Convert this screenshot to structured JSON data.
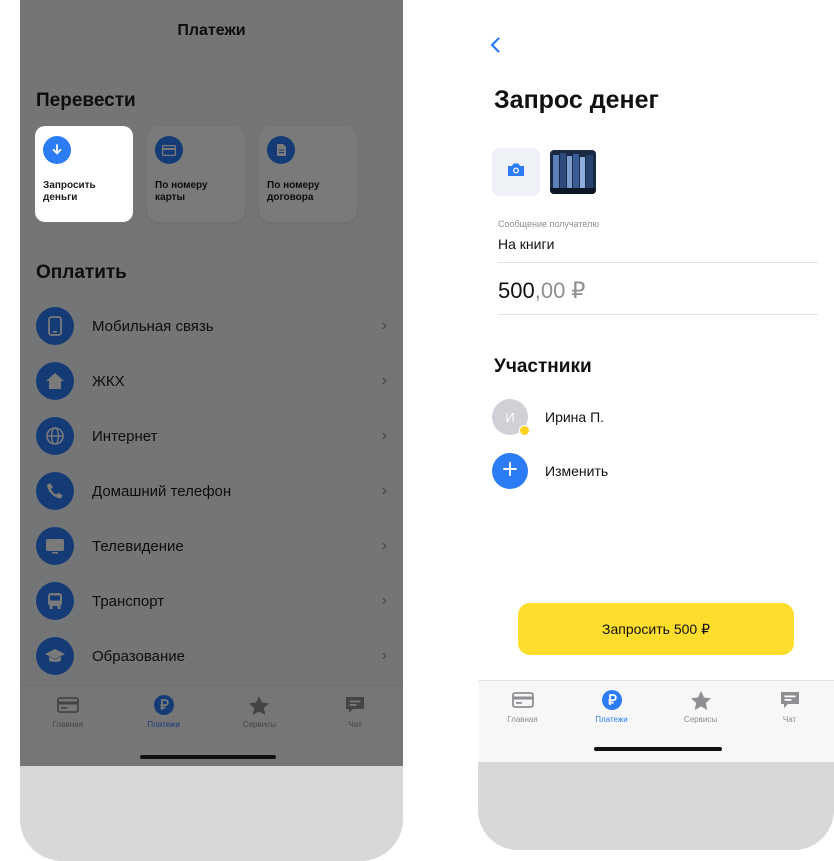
{
  "left_screen": {
    "title": "Платежи",
    "transfer": {
      "heading": "Перевести",
      "tiles": [
        {
          "label": "Запросить\nденьги",
          "icon": "arrow-down-circle-icon"
        },
        {
          "label": "По номеру\nкарты",
          "icon": "card-icon"
        },
        {
          "label": "По номеру\nдоговора",
          "icon": "document-icon"
        }
      ]
    },
    "pay": {
      "heading": "Оплатить",
      "items": [
        {
          "label": "Мобильная связь",
          "icon": "mobile-phone-icon"
        },
        {
          "label": "ЖКХ",
          "icon": "house-icon"
        },
        {
          "label": "Интернет",
          "icon": "globe-icon"
        },
        {
          "label": "Домашний телефон",
          "icon": "phone-handset-icon"
        },
        {
          "label": "Телевидение",
          "icon": "tv-icon"
        },
        {
          "label": "Транспорт",
          "icon": "bus-icon"
        },
        {
          "label": "Образование",
          "icon": "graduation-cap-icon"
        }
      ]
    },
    "tabbar": [
      {
        "label": "Главная",
        "icon": "card-icon",
        "active": false
      },
      {
        "label": "Платежи",
        "icon": "ruble-icon",
        "active": true
      },
      {
        "label": "Сервисы",
        "icon": "star-icon",
        "active": false
      },
      {
        "label": "Чат",
        "icon": "chat-icon",
        "active": false
      }
    ]
  },
  "right_screen": {
    "title": "Запрос денег",
    "message_label": "Сообщение получателю",
    "message_value": "На книги",
    "amount_int": "500",
    "amount_dec": ",00 ₽",
    "participants_heading": "Участники",
    "participant": {
      "initial": "И",
      "name": "Ирина П."
    },
    "change_label": "Изменить",
    "cta_label": "Запросить 500 ₽",
    "tabbar": [
      {
        "label": "Главная",
        "icon": "card-icon",
        "active": false
      },
      {
        "label": "Платежи",
        "icon": "ruble-icon",
        "active": true
      },
      {
        "label": "Сервисы",
        "icon": "star-icon",
        "active": false
      },
      {
        "label": "Чат",
        "icon": "chat-icon",
        "active": false
      }
    ]
  },
  "colors": {
    "accent_blue": "#2c7cf6",
    "cta_yellow": "#ffdd2d",
    "overlay": "rgba(0,0,0,0.52)"
  }
}
